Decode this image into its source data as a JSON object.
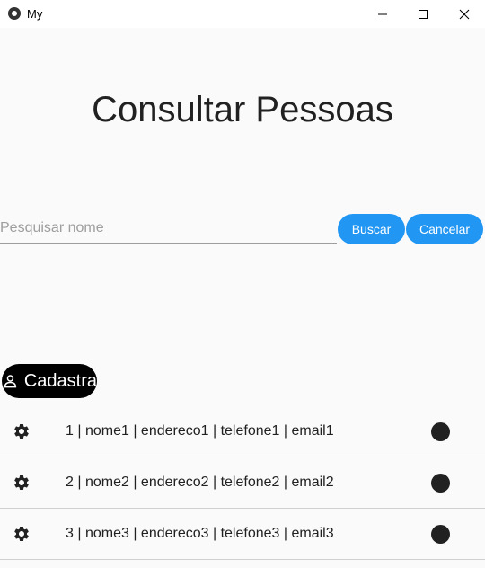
{
  "window": {
    "title": "My"
  },
  "page": {
    "heading": "Consultar Pessoas"
  },
  "search": {
    "placeholder": "Pesquisar nome",
    "value": ""
  },
  "buttons": {
    "buscar": "Buscar",
    "cancelar": "Cancelar",
    "cadastrar": "Cadastra"
  },
  "colors": {
    "accent": "#2196f3",
    "background": "#fafafa"
  },
  "people": [
    {
      "text": "1 | nome1 | endereco1 | telefone1 | email1"
    },
    {
      "text": "2 | nome2 | endereco2 | telefone2 | email2"
    },
    {
      "text": "3 | nome3 | endereco3 | telefone3 | email3"
    }
  ]
}
